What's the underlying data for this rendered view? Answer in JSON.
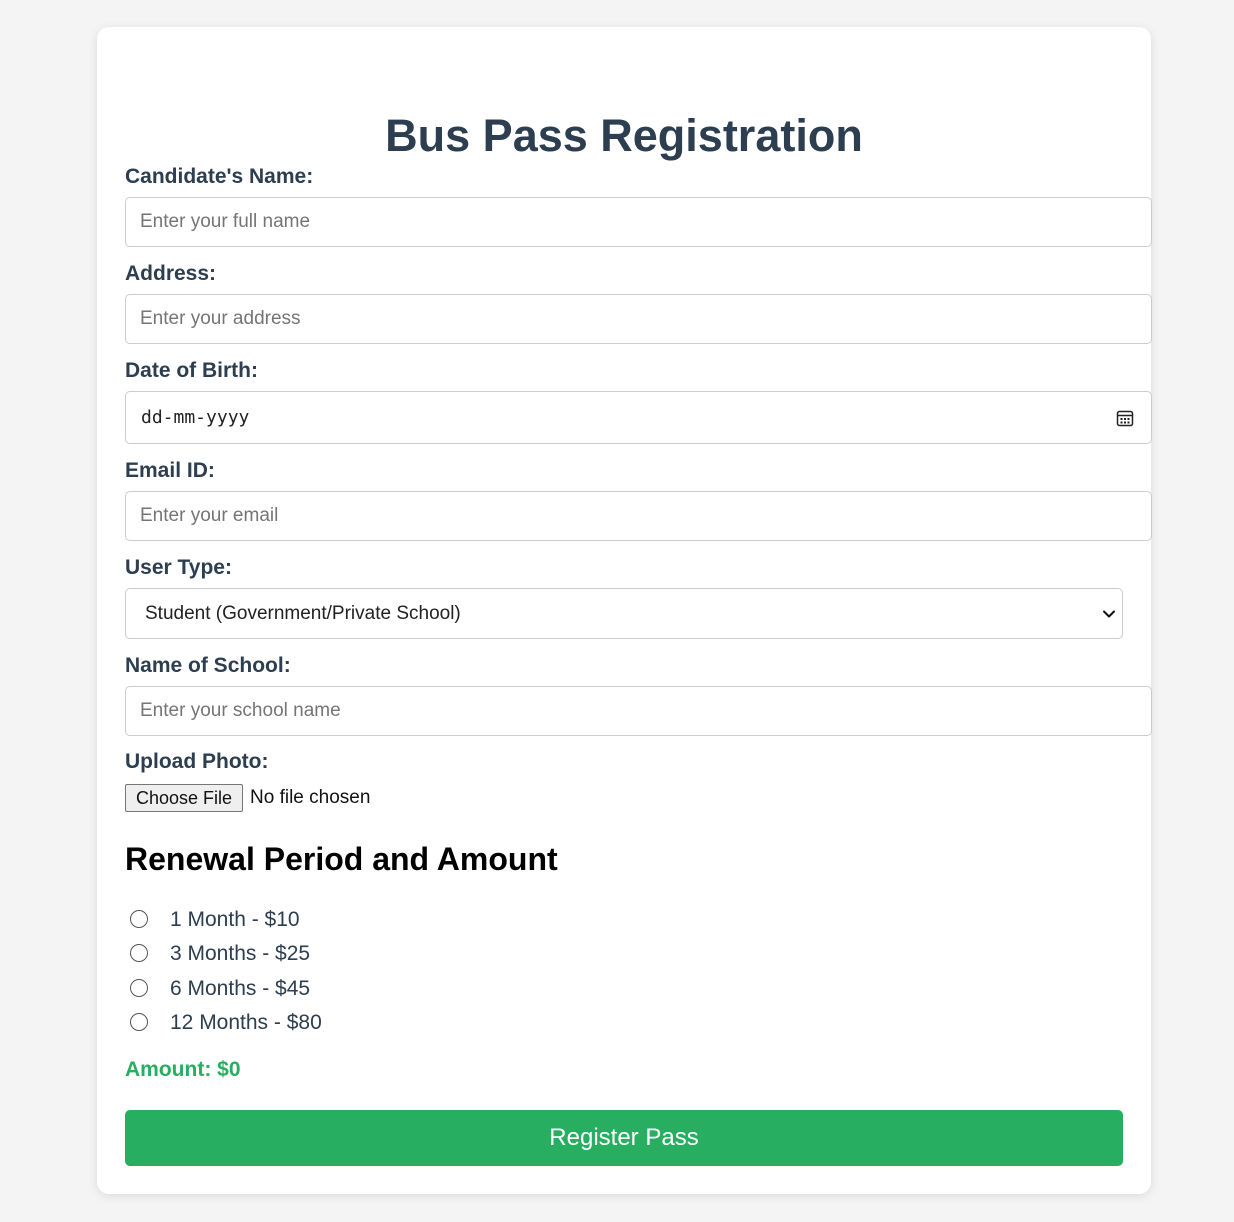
{
  "form": {
    "title": "Bus Pass Registration",
    "name": {
      "label": "Candidate's Name:",
      "placeholder": "Enter your full name"
    },
    "address": {
      "label": "Address:",
      "placeholder": "Enter your address"
    },
    "dob": {
      "label": "Date of Birth:",
      "placeholder": "dd-mm-yyyy",
      "icon": "calendar-icon"
    },
    "email": {
      "label": "Email ID:",
      "placeholder": "Enter your email"
    },
    "user_type": {
      "label": "User Type:",
      "selected": "Student (Government/Private School)",
      "icon": "chevron-down-icon"
    },
    "school": {
      "label": "Name of School:",
      "placeholder": "Enter your school name"
    },
    "photo": {
      "label": "Upload Photo:",
      "button_label": "Choose File",
      "status": "No file chosen"
    },
    "renewal": {
      "heading": "Renewal Period and Amount",
      "options": [
        {
          "label": "1 Month - $10",
          "checked": false
        },
        {
          "label": "3 Months - $25",
          "checked": false
        },
        {
          "label": "6 Months - $45",
          "checked": false
        },
        {
          "label": "12 Months - $80",
          "checked": false
        }
      ]
    },
    "amount_text": "Amount: $0",
    "submit_label": "Register Pass"
  },
  "colors": {
    "accent": "#27ae60",
    "heading": "#2c3e50",
    "background": "#f4f4f4"
  }
}
